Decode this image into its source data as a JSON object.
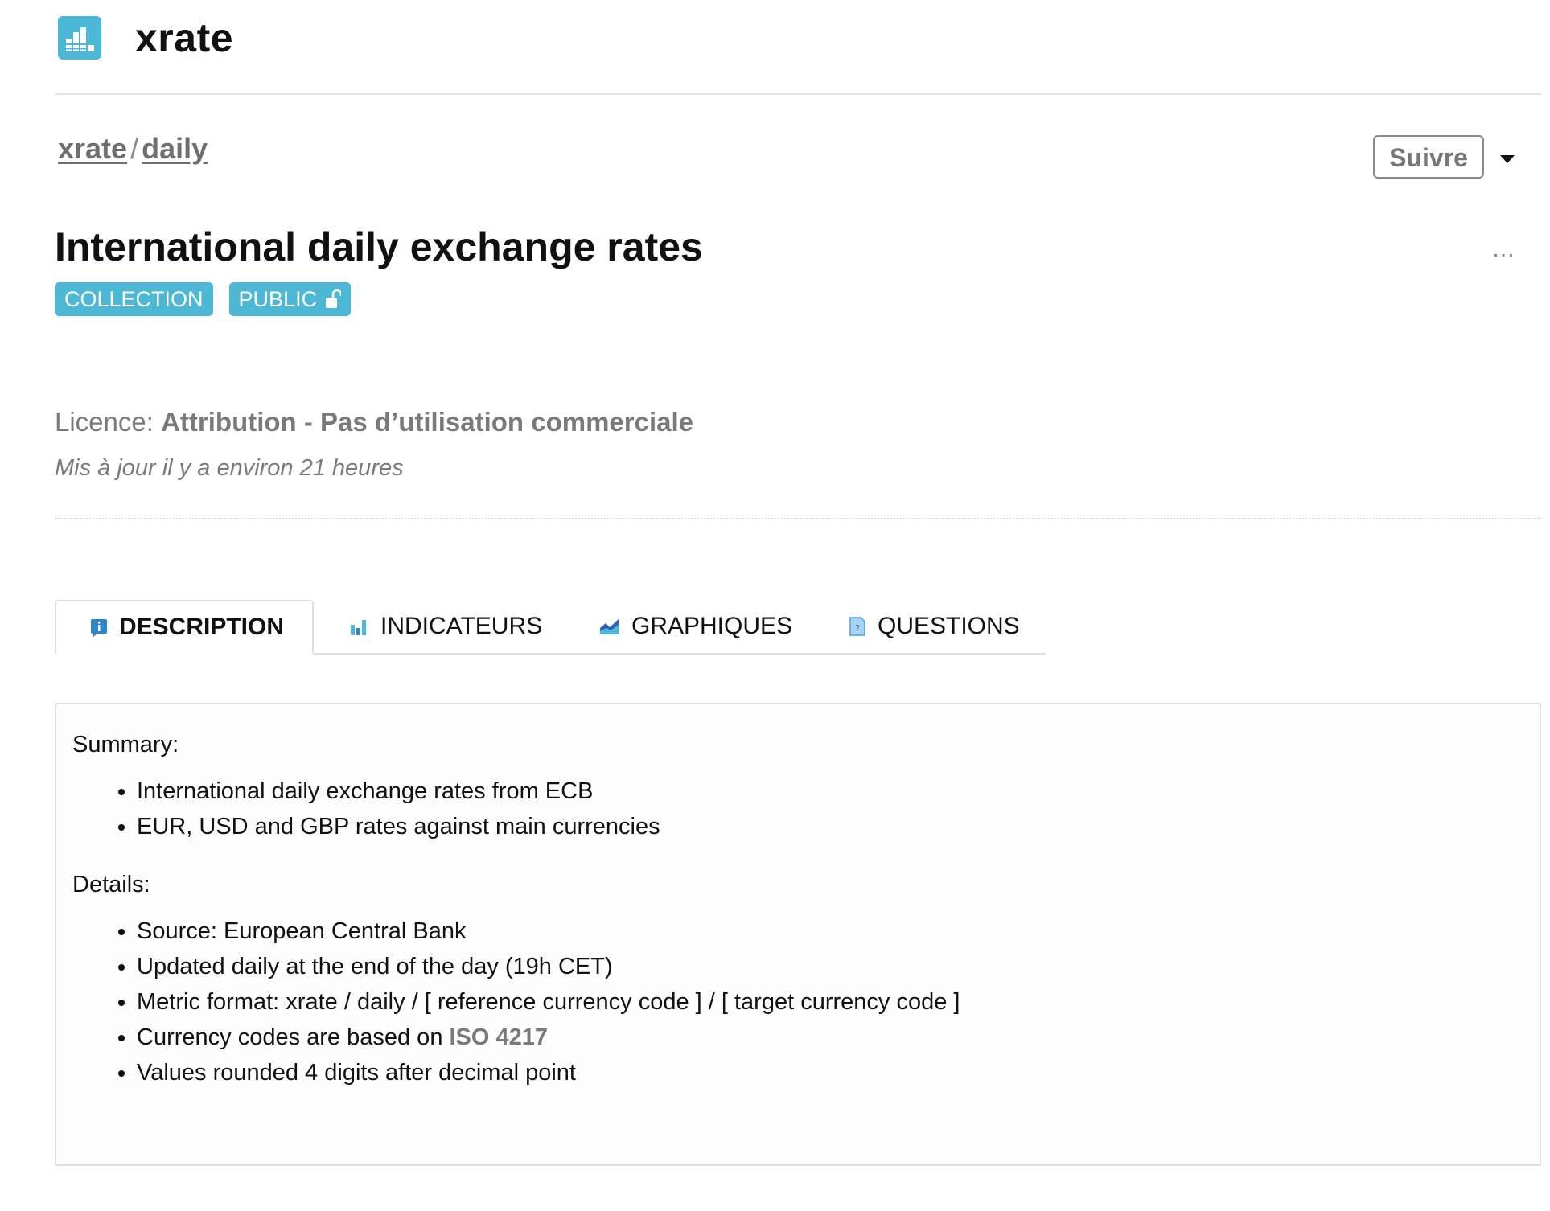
{
  "header": {
    "app_name": "xrate"
  },
  "breadcrumb": {
    "root": "xrate",
    "separator": "/",
    "current": "daily"
  },
  "follow_button": "Suivre",
  "title": "International daily exchange rates",
  "more_icon": "…",
  "badges": {
    "type": "COLLECTION",
    "visibility": "PUBLIC"
  },
  "licence": {
    "label": "Licence:",
    "value": "Attribution - Pas d’utilisation commerciale"
  },
  "updated": "Mis à jour il y a environ 21 heures",
  "tabs": [
    {
      "label": "DESCRIPTION",
      "icon": "info-icon",
      "active": true
    },
    {
      "label": "INDICATEURS",
      "icon": "bar-chart-icon",
      "active": false
    },
    {
      "label": "GRAPHIQUES",
      "icon": "area-chart-icon",
      "active": false
    },
    {
      "label": "QUESTIONS",
      "icon": "question-doc-icon",
      "active": false
    }
  ],
  "description": {
    "summary_label": "Summary:",
    "summary_items": [
      "International daily exchange rates from ECB",
      "EUR, USD and GBP rates against main currencies"
    ],
    "details_label": "Details:",
    "details_items": [
      "Source: European Central Bank",
      "Updated daily at the end of the day (19h CET)",
      "Metric format: xrate / daily / [ reference currency code ] / [ target currency code ]",
      "Currency codes are based on ",
      "Values rounded 4 digits after decimal point"
    ],
    "iso_link": "ISO 4217"
  },
  "colors": {
    "accent": "#4db8d6",
    "muted_text": "#7a7a7a",
    "border": "#e0e0e0"
  }
}
